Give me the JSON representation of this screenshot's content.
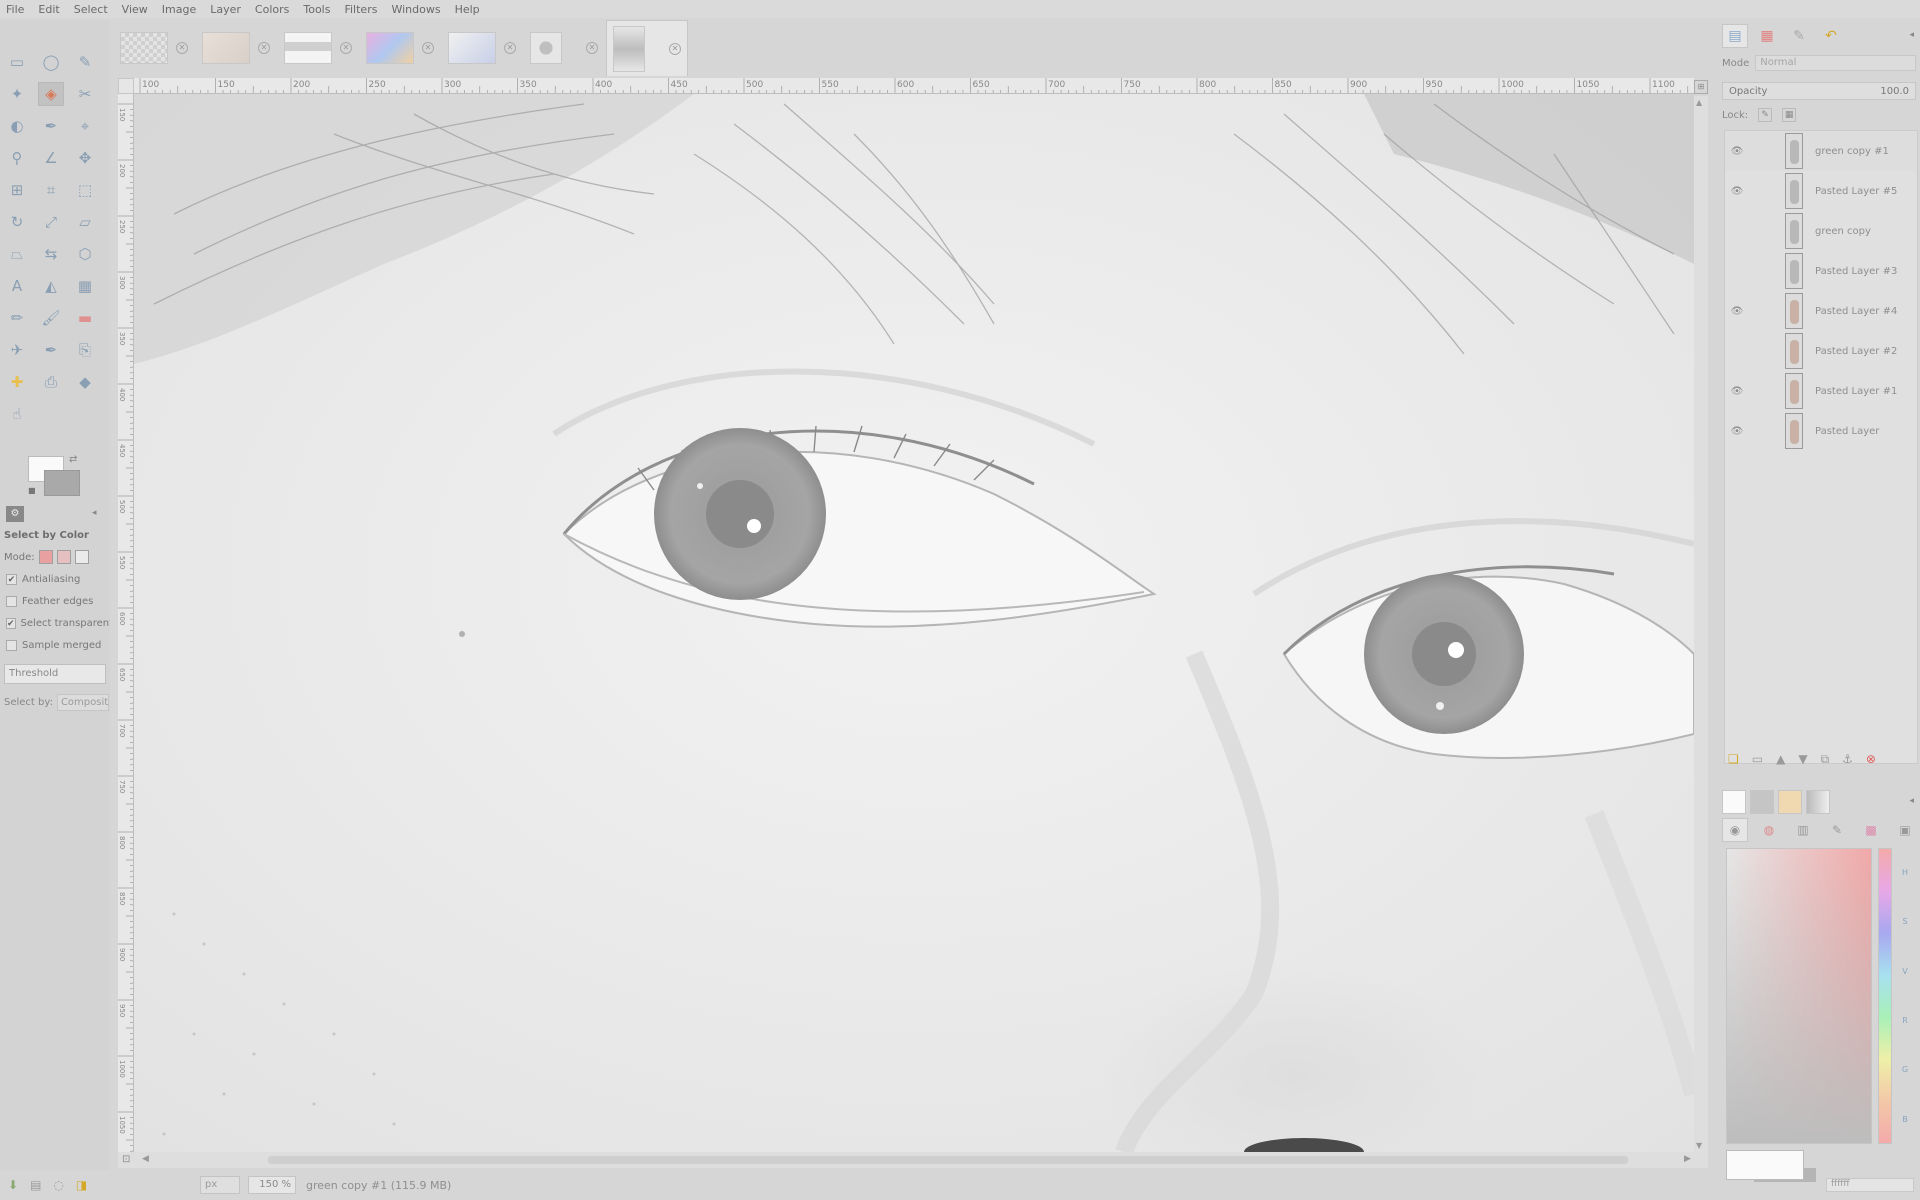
{
  "menu": [
    "File",
    "Edit",
    "Select",
    "View",
    "Image",
    "Layer",
    "Colors",
    "Tools",
    "Filters",
    "Windows",
    "Help"
  ],
  "toolbox": {
    "tools": [
      "rect-select",
      "ellipse-select",
      "free-select",
      "fuzzy-select",
      "by-color-select",
      "scissors-select",
      "foreground-select",
      "paths",
      "color-picker",
      "zoom",
      "measure",
      "move",
      "align",
      "crop",
      "unified-transform",
      "rotate",
      "scale",
      "shear",
      "perspective",
      "flip",
      "cage-transform",
      "text",
      "bucket-fill",
      "blend",
      "pencil",
      "paintbrush",
      "eraser",
      "airbrush",
      "ink",
      "clone",
      "heal",
      "perspective-clone",
      "blur-sharpen",
      "smudge"
    ],
    "active_tool": "by-color-select",
    "fg_color": "#fafafa",
    "bg_color": "#a9a9a9"
  },
  "tool_options": {
    "title": "Select by Color",
    "mode_label": "Mode:",
    "antialiasing": "Antialiasing",
    "antialiasing_checked": "✔",
    "feather": "Feather edges",
    "feather_checked": "",
    "transparent": "Select transparent areas",
    "transparent_checked": "✔",
    "sample": "Sample merged",
    "sample_checked": "",
    "threshold": "Threshold",
    "select_by_label": "Select by:",
    "select_by_value": "Composite"
  },
  "image_tabs": [
    {
      "thumb": "checker"
    },
    {
      "thumb": "lace"
    },
    {
      "thumb": "banner"
    },
    {
      "thumb": "colorful"
    },
    {
      "thumb": "card"
    },
    {
      "thumb": "bear"
    },
    {
      "thumb": "portrait",
      "active": true
    }
  ],
  "ruler": {
    "h_labels": [
      "100",
      "150",
      "200",
      "250",
      "300",
      "350",
      "400",
      "450",
      "500",
      "550",
      "600",
      "650",
      "700",
      "750",
      "800",
      "850",
      "900",
      "950",
      "1000",
      "1050",
      "1100"
    ],
    "v_labels": [
      "150",
      "200",
      "250",
      "300",
      "350",
      "400",
      "450",
      "500",
      "550",
      "600",
      "650",
      "700",
      "750",
      "800",
      "850",
      "900",
      "950",
      "1000",
      "1050"
    ]
  },
  "status": {
    "unit": "px",
    "zoom": "150 %",
    "text": "green copy #1 (115.9 MB)"
  },
  "layers_dock": {
    "mode_label": "Mode",
    "mode_value": "Normal",
    "opacity_label": "Opacity",
    "opacity_value": "100.0",
    "lock_label": "Lock:",
    "layers": [
      {
        "name": "green copy #1",
        "visible": true,
        "warm": false
      },
      {
        "name": "Pasted Layer #5",
        "visible": true,
        "warm": false
      },
      {
        "name": "green copy",
        "visible": false,
        "warm": false
      },
      {
        "name": "Pasted Layer #3",
        "visible": false,
        "warm": false
      },
      {
        "name": "Pasted Layer #4",
        "visible": true,
        "warm": true
      },
      {
        "name": "Pasted Layer #2",
        "visible": false,
        "warm": true
      },
      {
        "name": "Pasted Layer #1",
        "visible": true,
        "warm": true
      },
      {
        "name": "Pasted Layer",
        "visible": true,
        "warm": true
      }
    ]
  },
  "color_dock": {
    "channels": [
      "H",
      "S",
      "V",
      "R",
      "G",
      "B"
    ],
    "hex": "ffffff"
  }
}
